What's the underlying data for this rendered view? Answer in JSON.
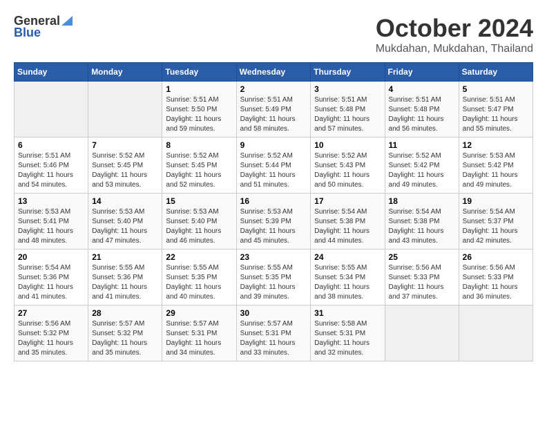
{
  "logo": {
    "general": "General",
    "blue": "Blue"
  },
  "title": "October 2024",
  "location": "Mukdahan, Mukdahan, Thailand",
  "weekdays": [
    "Sunday",
    "Monday",
    "Tuesday",
    "Wednesday",
    "Thursday",
    "Friday",
    "Saturday"
  ],
  "weeks": [
    [
      {
        "day": "",
        "sunrise": "",
        "sunset": "",
        "daylight": ""
      },
      {
        "day": "",
        "sunrise": "",
        "sunset": "",
        "daylight": ""
      },
      {
        "day": "1",
        "sunrise": "Sunrise: 5:51 AM",
        "sunset": "Sunset: 5:50 PM",
        "daylight": "Daylight: 11 hours and 59 minutes."
      },
      {
        "day": "2",
        "sunrise": "Sunrise: 5:51 AM",
        "sunset": "Sunset: 5:49 PM",
        "daylight": "Daylight: 11 hours and 58 minutes."
      },
      {
        "day": "3",
        "sunrise": "Sunrise: 5:51 AM",
        "sunset": "Sunset: 5:48 PM",
        "daylight": "Daylight: 11 hours and 57 minutes."
      },
      {
        "day": "4",
        "sunrise": "Sunrise: 5:51 AM",
        "sunset": "Sunset: 5:48 PM",
        "daylight": "Daylight: 11 hours and 56 minutes."
      },
      {
        "day": "5",
        "sunrise": "Sunrise: 5:51 AM",
        "sunset": "Sunset: 5:47 PM",
        "daylight": "Daylight: 11 hours and 55 minutes."
      }
    ],
    [
      {
        "day": "6",
        "sunrise": "Sunrise: 5:51 AM",
        "sunset": "Sunset: 5:46 PM",
        "daylight": "Daylight: 11 hours and 54 minutes."
      },
      {
        "day": "7",
        "sunrise": "Sunrise: 5:52 AM",
        "sunset": "Sunset: 5:45 PM",
        "daylight": "Daylight: 11 hours and 53 minutes."
      },
      {
        "day": "8",
        "sunrise": "Sunrise: 5:52 AM",
        "sunset": "Sunset: 5:45 PM",
        "daylight": "Daylight: 11 hours and 52 minutes."
      },
      {
        "day": "9",
        "sunrise": "Sunrise: 5:52 AM",
        "sunset": "Sunset: 5:44 PM",
        "daylight": "Daylight: 11 hours and 51 minutes."
      },
      {
        "day": "10",
        "sunrise": "Sunrise: 5:52 AM",
        "sunset": "Sunset: 5:43 PM",
        "daylight": "Daylight: 11 hours and 50 minutes."
      },
      {
        "day": "11",
        "sunrise": "Sunrise: 5:52 AM",
        "sunset": "Sunset: 5:42 PM",
        "daylight": "Daylight: 11 hours and 49 minutes."
      },
      {
        "day": "12",
        "sunrise": "Sunrise: 5:53 AM",
        "sunset": "Sunset: 5:42 PM",
        "daylight": "Daylight: 11 hours and 49 minutes."
      }
    ],
    [
      {
        "day": "13",
        "sunrise": "Sunrise: 5:53 AM",
        "sunset": "Sunset: 5:41 PM",
        "daylight": "Daylight: 11 hours and 48 minutes."
      },
      {
        "day": "14",
        "sunrise": "Sunrise: 5:53 AM",
        "sunset": "Sunset: 5:40 PM",
        "daylight": "Daylight: 11 hours and 47 minutes."
      },
      {
        "day": "15",
        "sunrise": "Sunrise: 5:53 AM",
        "sunset": "Sunset: 5:40 PM",
        "daylight": "Daylight: 11 hours and 46 minutes."
      },
      {
        "day": "16",
        "sunrise": "Sunrise: 5:53 AM",
        "sunset": "Sunset: 5:39 PM",
        "daylight": "Daylight: 11 hours and 45 minutes."
      },
      {
        "day": "17",
        "sunrise": "Sunrise: 5:54 AM",
        "sunset": "Sunset: 5:38 PM",
        "daylight": "Daylight: 11 hours and 44 minutes."
      },
      {
        "day": "18",
        "sunrise": "Sunrise: 5:54 AM",
        "sunset": "Sunset: 5:38 PM",
        "daylight": "Daylight: 11 hours and 43 minutes."
      },
      {
        "day": "19",
        "sunrise": "Sunrise: 5:54 AM",
        "sunset": "Sunset: 5:37 PM",
        "daylight": "Daylight: 11 hours and 42 minutes."
      }
    ],
    [
      {
        "day": "20",
        "sunrise": "Sunrise: 5:54 AM",
        "sunset": "Sunset: 5:36 PM",
        "daylight": "Daylight: 11 hours and 41 minutes."
      },
      {
        "day": "21",
        "sunrise": "Sunrise: 5:55 AM",
        "sunset": "Sunset: 5:36 PM",
        "daylight": "Daylight: 11 hours and 41 minutes."
      },
      {
        "day": "22",
        "sunrise": "Sunrise: 5:55 AM",
        "sunset": "Sunset: 5:35 PM",
        "daylight": "Daylight: 11 hours and 40 minutes."
      },
      {
        "day": "23",
        "sunrise": "Sunrise: 5:55 AM",
        "sunset": "Sunset: 5:35 PM",
        "daylight": "Daylight: 11 hours and 39 minutes."
      },
      {
        "day": "24",
        "sunrise": "Sunrise: 5:55 AM",
        "sunset": "Sunset: 5:34 PM",
        "daylight": "Daylight: 11 hours and 38 minutes."
      },
      {
        "day": "25",
        "sunrise": "Sunrise: 5:56 AM",
        "sunset": "Sunset: 5:33 PM",
        "daylight": "Daylight: 11 hours and 37 minutes."
      },
      {
        "day": "26",
        "sunrise": "Sunrise: 5:56 AM",
        "sunset": "Sunset: 5:33 PM",
        "daylight": "Daylight: 11 hours and 36 minutes."
      }
    ],
    [
      {
        "day": "27",
        "sunrise": "Sunrise: 5:56 AM",
        "sunset": "Sunset: 5:32 PM",
        "daylight": "Daylight: 11 hours and 35 minutes."
      },
      {
        "day": "28",
        "sunrise": "Sunrise: 5:57 AM",
        "sunset": "Sunset: 5:32 PM",
        "daylight": "Daylight: 11 hours and 35 minutes."
      },
      {
        "day": "29",
        "sunrise": "Sunrise: 5:57 AM",
        "sunset": "Sunset: 5:31 PM",
        "daylight": "Daylight: 11 hours and 34 minutes."
      },
      {
        "day": "30",
        "sunrise": "Sunrise: 5:57 AM",
        "sunset": "Sunset: 5:31 PM",
        "daylight": "Daylight: 11 hours and 33 minutes."
      },
      {
        "day": "31",
        "sunrise": "Sunrise: 5:58 AM",
        "sunset": "Sunset: 5:31 PM",
        "daylight": "Daylight: 11 hours and 32 minutes."
      },
      {
        "day": "",
        "sunrise": "",
        "sunset": "",
        "daylight": ""
      },
      {
        "day": "",
        "sunrise": "",
        "sunset": "",
        "daylight": ""
      }
    ]
  ]
}
